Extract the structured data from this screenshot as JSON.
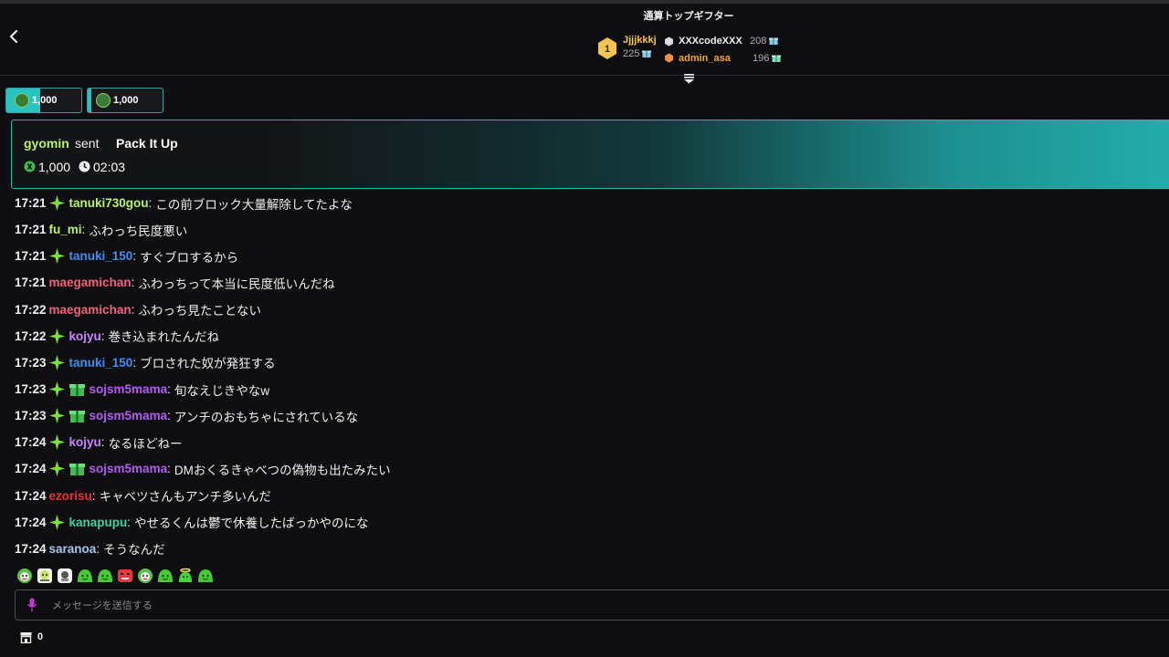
{
  "header": {
    "gifters_title": "通算トップギフター",
    "top_gifters": [
      {
        "rank": "1",
        "name": "Jjjjkkkj",
        "value": "225"
      },
      {
        "name": "XXXcodeXXX",
        "value": "208"
      },
      {
        "name": "admin_asa",
        "value": "196"
      }
    ]
  },
  "tips": [
    {
      "amount": "1,000",
      "progress": 0.45
    },
    {
      "amount": "1,000",
      "progress": 0.05
    }
  ],
  "gift_banner": {
    "user": "gyomin",
    "sent": "sent",
    "gift_name": "Pack It Up",
    "amount": "1,000",
    "time_left": "02:03"
  },
  "chat": [
    {
      "time": "17:21",
      "badges": [
        "sparkle"
      ],
      "user": "tanuki730gou",
      "color": "#b8f26b",
      "message": "この前ブロック大量解除してたよな"
    },
    {
      "time": "17:21",
      "badges": [],
      "user": "fu_mi",
      "color": "#b8f26b",
      "message": "ふわっち民度悪い"
    },
    {
      "time": "17:21",
      "badges": [
        "sparkle"
      ],
      "user": "tanuki_150",
      "color": "#3f8cf5",
      "message": "すぐブロするから"
    },
    {
      "time": "17:21",
      "badges": [],
      "user": "maegamichan",
      "color": "#f0617c",
      "message": "ふわっちって本当に民度低いんだね"
    },
    {
      "time": "17:22",
      "badges": [],
      "user": "maegamichan",
      "color": "#f0617c",
      "message": "ふわっち見たことない"
    },
    {
      "time": "17:22",
      "badges": [
        "sparkle"
      ],
      "user": "kojyu",
      "color": "#c785ff",
      "message": "巻き込まれたんだね"
    },
    {
      "time": "17:23",
      "badges": [
        "sparkle"
      ],
      "user": "tanuki_150",
      "color": "#3f8cf5",
      "message": "ブロされた奴が発狂する"
    },
    {
      "time": "17:23",
      "badges": [
        "sparkle",
        "gift"
      ],
      "user": "sojsm5mama",
      "color": "#b05cf5",
      "message": "旬なえじきやなw"
    },
    {
      "time": "17:23",
      "badges": [
        "sparkle",
        "gift"
      ],
      "user": "sojsm5mama",
      "color": "#b05cf5",
      "message": "アンチのおもちゃにされているな"
    },
    {
      "time": "17:24",
      "badges": [
        "sparkle"
      ],
      "user": "kojyu",
      "color": "#c785ff",
      "message": "なるほどねー"
    },
    {
      "time": "17:24",
      "badges": [
        "sparkle",
        "gift"
      ],
      "user": "sojsm5mama",
      "color": "#b05cf5",
      "message": "DMおくるきゃべつの偽物も出たみたい"
    },
    {
      "time": "17:24",
      "badges": [],
      "user": "ezorisu",
      "color": "#e8323c",
      "message": "キャベツさんもアンチ多いんだ"
    },
    {
      "time": "17:24",
      "badges": [
        "sparkle"
      ],
      "user": "kanapupu",
      "color": "#3ed0a8",
      "message": "やせるくんは鬱で休養したばっかやのにな"
    },
    {
      "time": "17:24",
      "badges": [],
      "user": "saranoa",
      "color": "#a9c4f0",
      "message": "そうなんだ"
    }
  ],
  "emotes": [
    "cabbage-face-emote",
    "skull-emote",
    "sticker-emote",
    "green-blob-emote",
    "green-blob-emote",
    "red-angry-emote",
    "cabbage-face-emote",
    "green-blob-emote",
    "angel-blob-emote",
    "green-blob-emote"
  ],
  "input": {
    "placeholder": "メッセージを送信する"
  },
  "store": {
    "count": "0"
  },
  "colors": {
    "accent": "#27c2c4",
    "background": "#0e0e10",
    "gift_green": "#b8f26b"
  }
}
